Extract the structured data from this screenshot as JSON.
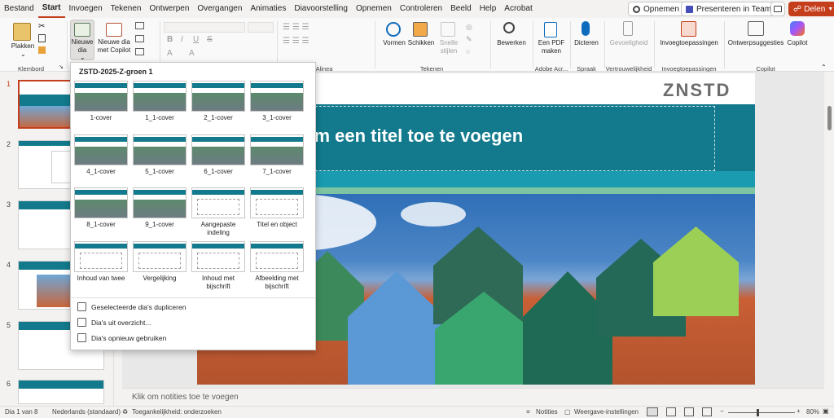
{
  "menu": {
    "tabs": [
      "Bestand",
      "Start",
      "Invoegen",
      "Tekenen",
      "Ontwerpen",
      "Overgangen",
      "Animaties",
      "Diavoorstelling",
      "Opnemen",
      "Controleren",
      "Beeld",
      "Help",
      "Acrobat"
    ],
    "active": "Start",
    "record_btn": "Opnemen",
    "teams_btn": "Presenteren in Teams",
    "share_btn": "Delen"
  },
  "ribbon": {
    "paste": "Plakken",
    "new_slide_line1": "Nieuwe",
    "new_slide_line2": "dia",
    "copilot_slide_line1": "Nieuwe dia",
    "copilot_slide_line2": "met Copilot",
    "clipboard_group": "Klembord",
    "alinea_group": "Alinea",
    "shapes": "Vormen",
    "arrange": "Schikken",
    "quick_styles_line1": "Snelle",
    "quick_styles_line2": "stijlen",
    "draw_group": "Tekenen",
    "editing": "Bewerken",
    "pdf_line1": "Een PDF",
    "pdf_line2": "maken",
    "acrobat_group": "Adobe Acr...",
    "dictate": "Dicteren",
    "speech_group": "Spraak",
    "sensitivity": "Gevoeligheid",
    "trust_group": "Vertrouwelijkheid",
    "addins": "Invoegtoepassingen",
    "addins_group": "Invoegtoepassingen",
    "designer": "Ontwerpsuggesties",
    "copilot": "Copilot",
    "copilot_group": "Copilot"
  },
  "gallery": {
    "title": "ZSTD-2025-Z-groen 1",
    "layouts": [
      "1-cover",
      "1_1-cover",
      "2_1-cover",
      "3_1-cover",
      "4_1-cover",
      "5_1-cover",
      "6_1-cover",
      "7_1-cover",
      "8_1-cover",
      "9_1-cover",
      "Aangepaste indeling",
      "Titel en object",
      "Inhoud van twee",
      "Vergelijking",
      "Inhoud met bijschrift",
      "Afbeelding met bijschrift"
    ],
    "commands": [
      "Geselecteerde dia's dupliceren",
      "Dia's uit overzicht...",
      "Dia's opnieuw gebruiken"
    ]
  },
  "thumbnails": [
    "1",
    "2",
    "3",
    "4",
    "5",
    "6"
  ],
  "slide": {
    "logo": "ZNSTD",
    "title_placeholder": "om een titel toe te voegen"
  },
  "notes": "Klik om notities toe te voegen",
  "status": {
    "slide_count": "Dia 1 van 8",
    "language": "Nederlands (standaard)",
    "accessibility": "Toegankelijkheid: onderzoeken",
    "notes_btn": "Notities",
    "view_settings": "Weergave-instellingen",
    "zoom": "80%"
  },
  "colors": {
    "accent": "#c43e1c",
    "teal": "#127a8c",
    "green": "#5db13f",
    "share": "#c43e1c"
  }
}
